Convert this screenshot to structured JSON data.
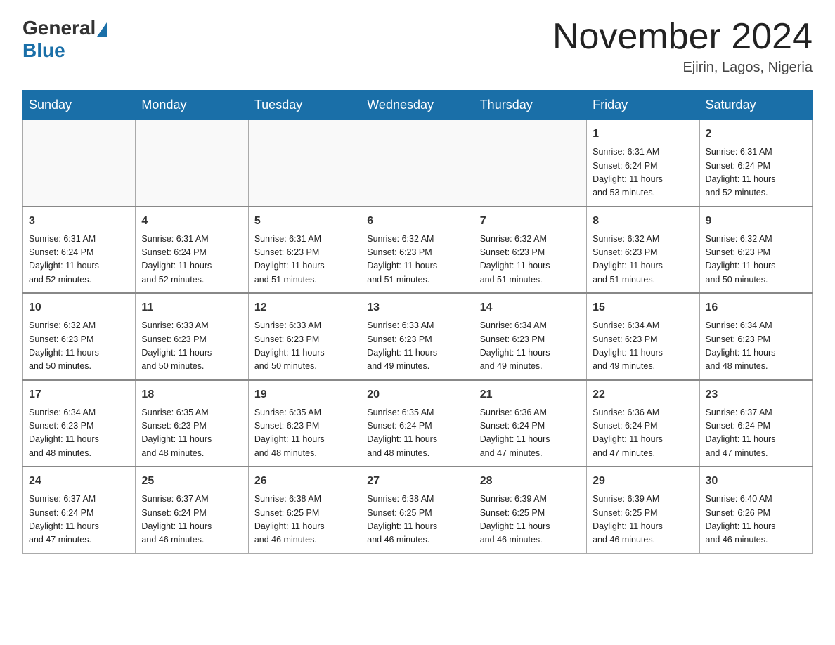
{
  "header": {
    "logo_general": "General",
    "logo_blue": "Blue",
    "month_title": "November 2024",
    "location": "Ejirin, Lagos, Nigeria"
  },
  "weekdays": [
    "Sunday",
    "Monday",
    "Tuesday",
    "Wednesday",
    "Thursday",
    "Friday",
    "Saturday"
  ],
  "weeks": [
    [
      {
        "day": "",
        "info": ""
      },
      {
        "day": "",
        "info": ""
      },
      {
        "day": "",
        "info": ""
      },
      {
        "day": "",
        "info": ""
      },
      {
        "day": "",
        "info": ""
      },
      {
        "day": "1",
        "info": "Sunrise: 6:31 AM\nSunset: 6:24 PM\nDaylight: 11 hours\nand 53 minutes."
      },
      {
        "day": "2",
        "info": "Sunrise: 6:31 AM\nSunset: 6:24 PM\nDaylight: 11 hours\nand 52 minutes."
      }
    ],
    [
      {
        "day": "3",
        "info": "Sunrise: 6:31 AM\nSunset: 6:24 PM\nDaylight: 11 hours\nand 52 minutes."
      },
      {
        "day": "4",
        "info": "Sunrise: 6:31 AM\nSunset: 6:24 PM\nDaylight: 11 hours\nand 52 minutes."
      },
      {
        "day": "5",
        "info": "Sunrise: 6:31 AM\nSunset: 6:23 PM\nDaylight: 11 hours\nand 51 minutes."
      },
      {
        "day": "6",
        "info": "Sunrise: 6:32 AM\nSunset: 6:23 PM\nDaylight: 11 hours\nand 51 minutes."
      },
      {
        "day": "7",
        "info": "Sunrise: 6:32 AM\nSunset: 6:23 PM\nDaylight: 11 hours\nand 51 minutes."
      },
      {
        "day": "8",
        "info": "Sunrise: 6:32 AM\nSunset: 6:23 PM\nDaylight: 11 hours\nand 51 minutes."
      },
      {
        "day": "9",
        "info": "Sunrise: 6:32 AM\nSunset: 6:23 PM\nDaylight: 11 hours\nand 50 minutes."
      }
    ],
    [
      {
        "day": "10",
        "info": "Sunrise: 6:32 AM\nSunset: 6:23 PM\nDaylight: 11 hours\nand 50 minutes."
      },
      {
        "day": "11",
        "info": "Sunrise: 6:33 AM\nSunset: 6:23 PM\nDaylight: 11 hours\nand 50 minutes."
      },
      {
        "day": "12",
        "info": "Sunrise: 6:33 AM\nSunset: 6:23 PM\nDaylight: 11 hours\nand 50 minutes."
      },
      {
        "day": "13",
        "info": "Sunrise: 6:33 AM\nSunset: 6:23 PM\nDaylight: 11 hours\nand 49 minutes."
      },
      {
        "day": "14",
        "info": "Sunrise: 6:34 AM\nSunset: 6:23 PM\nDaylight: 11 hours\nand 49 minutes."
      },
      {
        "day": "15",
        "info": "Sunrise: 6:34 AM\nSunset: 6:23 PM\nDaylight: 11 hours\nand 49 minutes."
      },
      {
        "day": "16",
        "info": "Sunrise: 6:34 AM\nSunset: 6:23 PM\nDaylight: 11 hours\nand 48 minutes."
      }
    ],
    [
      {
        "day": "17",
        "info": "Sunrise: 6:34 AM\nSunset: 6:23 PM\nDaylight: 11 hours\nand 48 minutes."
      },
      {
        "day": "18",
        "info": "Sunrise: 6:35 AM\nSunset: 6:23 PM\nDaylight: 11 hours\nand 48 minutes."
      },
      {
        "day": "19",
        "info": "Sunrise: 6:35 AM\nSunset: 6:23 PM\nDaylight: 11 hours\nand 48 minutes."
      },
      {
        "day": "20",
        "info": "Sunrise: 6:35 AM\nSunset: 6:24 PM\nDaylight: 11 hours\nand 48 minutes."
      },
      {
        "day": "21",
        "info": "Sunrise: 6:36 AM\nSunset: 6:24 PM\nDaylight: 11 hours\nand 47 minutes."
      },
      {
        "day": "22",
        "info": "Sunrise: 6:36 AM\nSunset: 6:24 PM\nDaylight: 11 hours\nand 47 minutes."
      },
      {
        "day": "23",
        "info": "Sunrise: 6:37 AM\nSunset: 6:24 PM\nDaylight: 11 hours\nand 47 minutes."
      }
    ],
    [
      {
        "day": "24",
        "info": "Sunrise: 6:37 AM\nSunset: 6:24 PM\nDaylight: 11 hours\nand 47 minutes."
      },
      {
        "day": "25",
        "info": "Sunrise: 6:37 AM\nSunset: 6:24 PM\nDaylight: 11 hours\nand 46 minutes."
      },
      {
        "day": "26",
        "info": "Sunrise: 6:38 AM\nSunset: 6:25 PM\nDaylight: 11 hours\nand 46 minutes."
      },
      {
        "day": "27",
        "info": "Sunrise: 6:38 AM\nSunset: 6:25 PM\nDaylight: 11 hours\nand 46 minutes."
      },
      {
        "day": "28",
        "info": "Sunrise: 6:39 AM\nSunset: 6:25 PM\nDaylight: 11 hours\nand 46 minutes."
      },
      {
        "day": "29",
        "info": "Sunrise: 6:39 AM\nSunset: 6:25 PM\nDaylight: 11 hours\nand 46 minutes."
      },
      {
        "day": "30",
        "info": "Sunrise: 6:40 AM\nSunset: 6:26 PM\nDaylight: 11 hours\nand 46 minutes."
      }
    ]
  ]
}
